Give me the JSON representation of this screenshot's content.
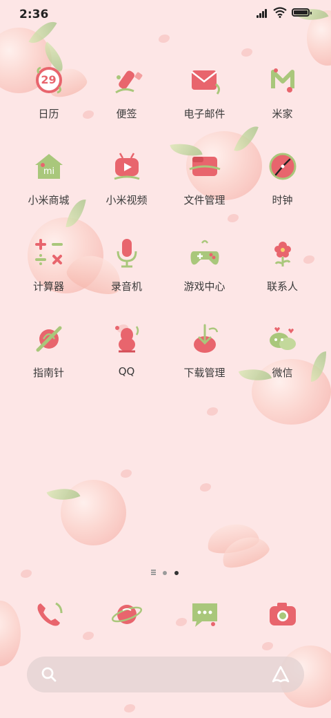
{
  "status_bar": {
    "time": "2:36"
  },
  "apps": [
    {
      "label": "日历",
      "icon": "calendar-icon",
      "badge": "29"
    },
    {
      "label": "便签",
      "icon": "notes-icon"
    },
    {
      "label": "电子邮件",
      "icon": "email-icon"
    },
    {
      "label": "米家",
      "icon": "mijia-icon"
    },
    {
      "label": "小米商城",
      "icon": "mi-store-icon"
    },
    {
      "label": "小米视频",
      "icon": "mi-video-icon"
    },
    {
      "label": "文件管理",
      "icon": "file-manager-icon"
    },
    {
      "label": "时钟",
      "icon": "clock-icon"
    },
    {
      "label": "计算器",
      "icon": "calculator-icon"
    },
    {
      "label": "录音机",
      "icon": "recorder-icon"
    },
    {
      "label": "游戏中心",
      "icon": "game-center-icon"
    },
    {
      "label": "联系人",
      "icon": "contacts-icon"
    },
    {
      "label": "指南针",
      "icon": "compass-icon"
    },
    {
      "label": "QQ",
      "icon": "qq-icon"
    },
    {
      "label": "下载管理",
      "icon": "download-manager-icon"
    },
    {
      "label": "微信",
      "icon": "wechat-icon"
    }
  ],
  "dock": [
    {
      "icon": "phone-icon"
    },
    {
      "icon": "browser-icon"
    },
    {
      "icon": "messages-icon"
    },
    {
      "icon": "camera-icon"
    }
  ],
  "page_indicator": {
    "pages": 3,
    "current": 3
  },
  "search": {
    "placeholder": ""
  },
  "colors": {
    "pink": "#e8656d",
    "green": "#a9c77b",
    "background": "#fde6e6"
  }
}
